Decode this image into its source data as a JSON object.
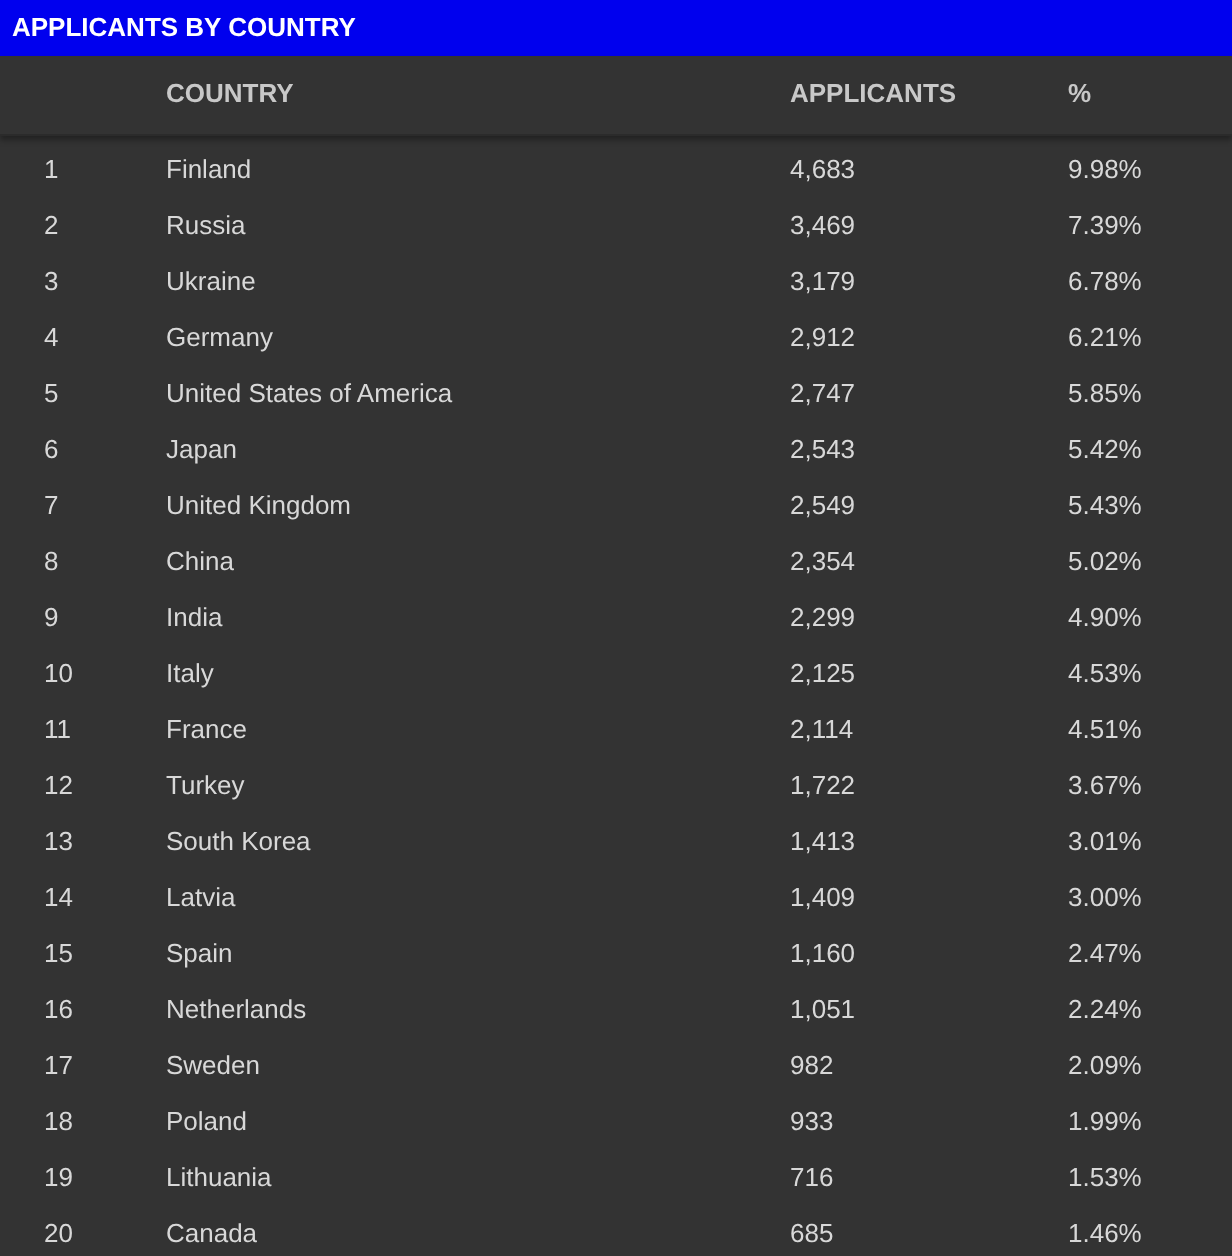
{
  "title": "APPLICANTS BY COUNTRY",
  "table": {
    "columns": [
      "COUNTRY",
      "APPLICANTS",
      "%"
    ],
    "rows": [
      {
        "rank": "1",
        "country": "Finland",
        "applicants": "4,683",
        "percent": "9.98%"
      },
      {
        "rank": "2",
        "country": "Russia",
        "applicants": "3,469",
        "percent": "7.39%"
      },
      {
        "rank": "3",
        "country": "Ukraine",
        "applicants": "3,179",
        "percent": "6.78%"
      },
      {
        "rank": "4",
        "country": "Germany",
        "applicants": "2,912",
        "percent": "6.21%"
      },
      {
        "rank": "5",
        "country": "United States of America",
        "applicants": "2,747",
        "percent": "5.85%"
      },
      {
        "rank": "6",
        "country": "Japan",
        "applicants": "2,543",
        "percent": "5.42%"
      },
      {
        "rank": "7",
        "country": "United Kingdom",
        "applicants": "2,549",
        "percent": "5.43%"
      },
      {
        "rank": "8",
        "country": "China",
        "applicants": "2,354",
        "percent": "5.02%"
      },
      {
        "rank": "9",
        "country": "India",
        "applicants": "2,299",
        "percent": "4.90%"
      },
      {
        "rank": "10",
        "country": "Italy",
        "applicants": "2,125",
        "percent": "4.53%"
      },
      {
        "rank": "11",
        "country": "France",
        "applicants": "2,114",
        "percent": "4.51%"
      },
      {
        "rank": "12",
        "country": "Turkey",
        "applicants": "1,722",
        "percent": "3.67%"
      },
      {
        "rank": "13",
        "country": "South Korea",
        "applicants": "1,413",
        "percent": "3.01%"
      },
      {
        "rank": "14",
        "country": "Latvia",
        "applicants": "1,409",
        "percent": "3.00%"
      },
      {
        "rank": "15",
        "country": "Spain",
        "applicants": "1,160",
        "percent": "2.47%"
      },
      {
        "rank": "16",
        "country": "Netherlands",
        "applicants": "1,051",
        "percent": "2.24%"
      },
      {
        "rank": "17",
        "country": "Sweden",
        "applicants": "982",
        "percent": "2.09%"
      },
      {
        "rank": "18",
        "country": "Poland",
        "applicants": "933",
        "percent": "1.99%"
      },
      {
        "rank": "19",
        "country": "Lithuania",
        "applicants": "716",
        "percent": "1.53%"
      },
      {
        "rank": "20",
        "country": "Canada",
        "applicants": "685",
        "percent": "1.46%"
      }
    ]
  }
}
